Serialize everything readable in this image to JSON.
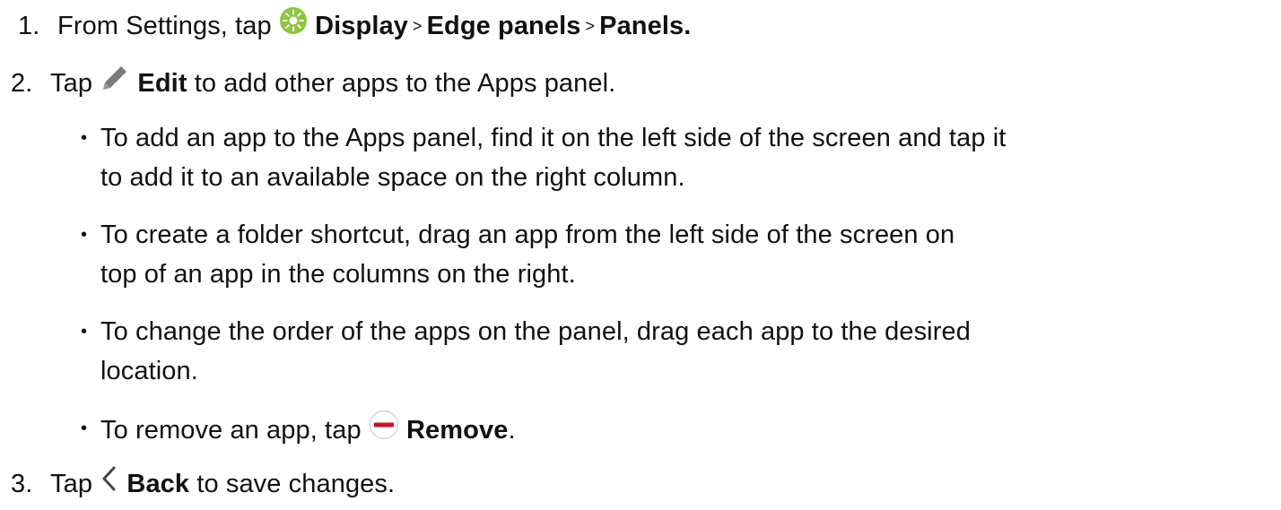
{
  "steps": [
    {
      "number": "1.",
      "text_1": "From Settings, tap",
      "bold_1": "Display",
      "sep_1": ">",
      "bold_2": "Edge panels",
      "sep_2": ">",
      "bold_3": "Panels.",
      "icon": "display-settings-icon"
    },
    {
      "number": "2.",
      "text_1": "Tap",
      "bold_1": "Edit",
      "text_2": "to add other apps to the Apps panel.",
      "icon": "edit-pencil-icon"
    },
    {
      "number": "3.",
      "text_1": "Tap",
      "bold_1": "Back",
      "text_2": "to save changes.",
      "icon": "back-chevron-icon"
    }
  ],
  "bullets": [
    {
      "line_1": "To add an app to the Apps panel, find it on the left side of the screen and tap it",
      "line_2": "to add it to an available space on the right column."
    },
    {
      "line_1": "To create a folder shortcut, drag an app from the left side of the screen on",
      "line_2": "top of an app in the columns on the right."
    },
    {
      "line_1": "To change the order of the apps on the panel, drag each app to the desired",
      "line_2": "location."
    },
    {
      "text_1": "To remove an app, tap",
      "bold_1": "Remove",
      "text_2": ".",
      "icon": "remove-minus-icon"
    }
  ],
  "colors": {
    "text": "#111111",
    "display_icon_green": "#8cc63f",
    "pencil_gray": "#7a7a7a",
    "remove_red": "#c8102e"
  }
}
